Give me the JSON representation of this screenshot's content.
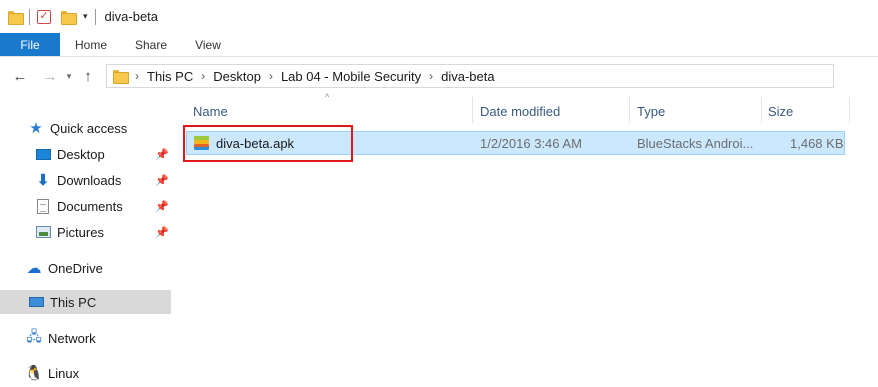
{
  "titlebar": {
    "title": "diva-beta",
    "icons": [
      "folder-icon",
      "properties-check-icon",
      "new-folder-icon",
      "customize-dropdown-icon"
    ]
  },
  "ribbon": {
    "tabs": [
      {
        "label": "File"
      },
      {
        "label": "Home"
      },
      {
        "label": "Share"
      },
      {
        "label": "View"
      }
    ]
  },
  "address": {
    "back_icon": "←",
    "forward_icon": "→",
    "recent_icon": "▾",
    "up_icon": "↑",
    "crumbs": [
      "This PC",
      "Desktop",
      "Lab 04 - Mobile Security",
      "diva-beta"
    ]
  },
  "navpane": {
    "items": [
      {
        "label": "Quick access",
        "icon": "star-icon"
      },
      {
        "label": "Desktop",
        "icon": "desktop-icon",
        "pinned": true
      },
      {
        "label": "Downloads",
        "icon": "download-icon",
        "pinned": true
      },
      {
        "label": "Documents",
        "icon": "documents-icon",
        "pinned": true
      },
      {
        "label": "Pictures",
        "icon": "pictures-icon",
        "pinned": true
      },
      {
        "label": "OneDrive",
        "icon": "cloud-icon"
      },
      {
        "label": "This PC",
        "icon": "computer-icon",
        "selected": true
      },
      {
        "label": "Network",
        "icon": "network-icon"
      },
      {
        "label": "Linux",
        "icon": "linux-icon"
      }
    ]
  },
  "filelist": {
    "sort_indicator": "^",
    "columns": [
      "Name",
      "Date modified",
      "Type",
      "Size"
    ],
    "rows": [
      {
        "name": "diva-beta.apk",
        "date": "1/2/2016 3:46 AM",
        "type": "BlueStacks Androi...",
        "size": "1,468 KB",
        "icon": "bluestacks-apk-icon",
        "selected": true,
        "highlighted": true
      }
    ]
  },
  "colors": {
    "file_tab": "#1979ca",
    "selection_bg": "#cce8ff",
    "highlight_border": "#e3161c"
  }
}
